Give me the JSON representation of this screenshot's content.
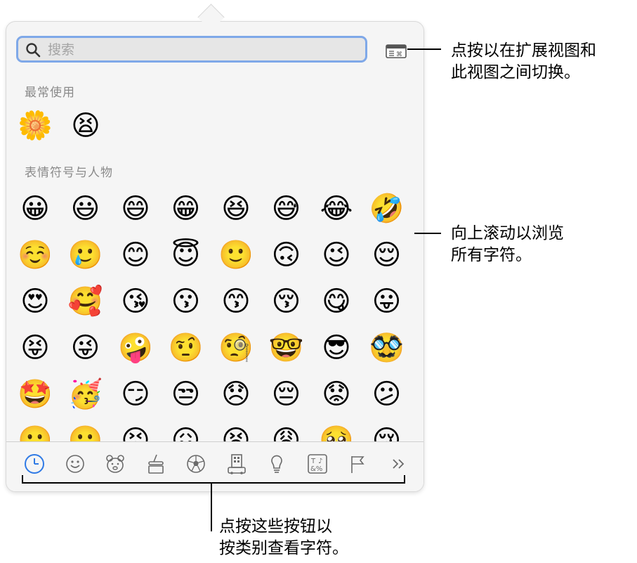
{
  "search": {
    "placeholder": "搜索"
  },
  "sections": {
    "frequent_title": "最常使用",
    "smileys_title": "表情符号与人物"
  },
  "frequent": [
    "🌼",
    "😫"
  ],
  "smileys": [
    [
      "😀",
      "😃",
      "😄",
      "😁",
      "😆",
      "😅",
      "😂",
      "🤣"
    ],
    [
      "☺️",
      "🥲",
      "😊",
      "😇",
      "🙂",
      "🙃",
      "😉",
      "😌"
    ],
    [
      "😍",
      "🥰",
      "😘",
      "😗",
      "😙",
      "😚",
      "😋",
      "😛"
    ],
    [
      "😝",
      "😜",
      "🤪",
      "🤨",
      "🧐",
      "🤓",
      "😎",
      "🥸"
    ],
    [
      "🤩",
      "🥳",
      "😏",
      "😒",
      "😞",
      "😔",
      "😟",
      "😕"
    ],
    [
      "🙁",
      "☹️",
      "😣",
      "😖",
      "😫",
      "😩",
      "🥺",
      "😢"
    ]
  ],
  "tabs": [
    {
      "name": "recent-tab",
      "icon": "clock-icon",
      "selected": true
    },
    {
      "name": "smileys-tab",
      "icon": "smiley-icon"
    },
    {
      "name": "animals-tab",
      "icon": "bear-icon"
    },
    {
      "name": "food-tab",
      "icon": "food-icon"
    },
    {
      "name": "activity-tab",
      "icon": "soccer-ball-icon"
    },
    {
      "name": "travel-tab",
      "icon": "building-icon"
    },
    {
      "name": "objects-tab",
      "icon": "lightbulb-icon"
    },
    {
      "name": "symbols-tab",
      "icon": "symbols-icon"
    },
    {
      "name": "flags-tab",
      "icon": "flag-icon"
    },
    {
      "name": "more-tab",
      "icon": "chevron-double-right-icon"
    }
  ],
  "callouts": {
    "toggle": [
      "点按以在扩展视图和",
      "此视图之间切换。"
    ],
    "scroll": [
      "向上滚动以浏览",
      "所有字符。"
    ],
    "categories": [
      "点按这些按钮以",
      "按类别查看字符。"
    ]
  },
  "colors": {
    "accent": "#2f7ae5",
    "search_border": "#7fa8e8"
  }
}
